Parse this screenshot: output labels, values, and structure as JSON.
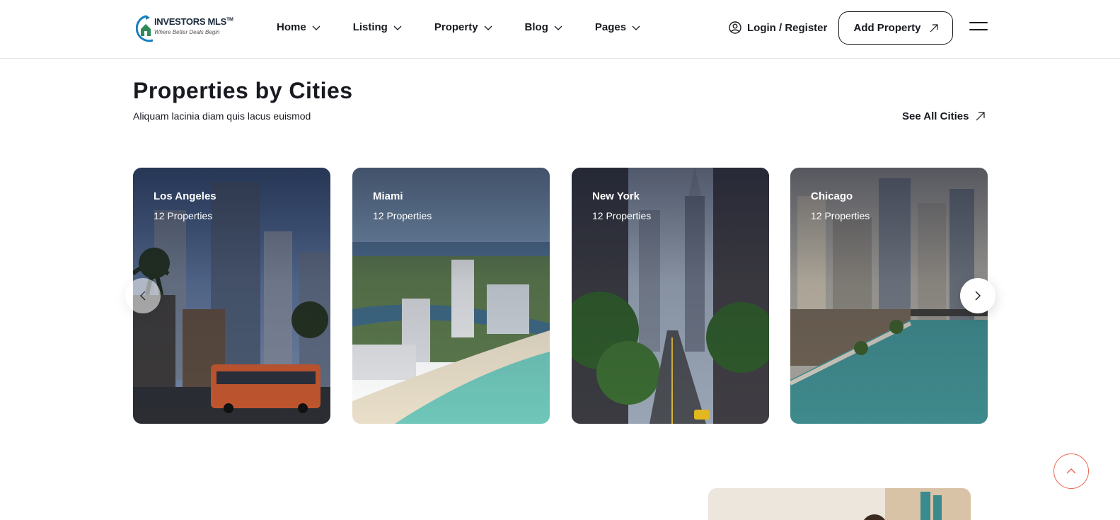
{
  "header": {
    "logo": {
      "name": "INVESTORS MLS",
      "tm": "TM",
      "tagline": "Where Better Deals Begin"
    },
    "nav": [
      {
        "label": "Home"
      },
      {
        "label": "Listing"
      },
      {
        "label": "Property"
      },
      {
        "label": "Blog"
      },
      {
        "label": "Pages"
      }
    ],
    "login_label": "Login / Register",
    "add_property_label": "Add Property"
  },
  "section": {
    "title": "Properties by Cities",
    "subtitle": "Aliquam lacinia diam quis lacus euismod",
    "see_all_label": "See All Cities"
  },
  "cities": [
    {
      "name": "Los Angeles",
      "count": "12 Properties"
    },
    {
      "name": "Miami",
      "count": "12 Properties"
    },
    {
      "name": "New York",
      "count": "12 Properties"
    },
    {
      "name": "Chicago",
      "count": "12 Properties"
    }
  ],
  "colors": {
    "text": "#181a20",
    "accent": "#eb6753",
    "border": "#e5e5e5"
  },
  "icons": {
    "user": "user-circle-icon",
    "arrow_up_right": "arrow-up-right-icon",
    "chevron": "chevron-down-icon",
    "menu": "hamburger-menu-icon"
  }
}
